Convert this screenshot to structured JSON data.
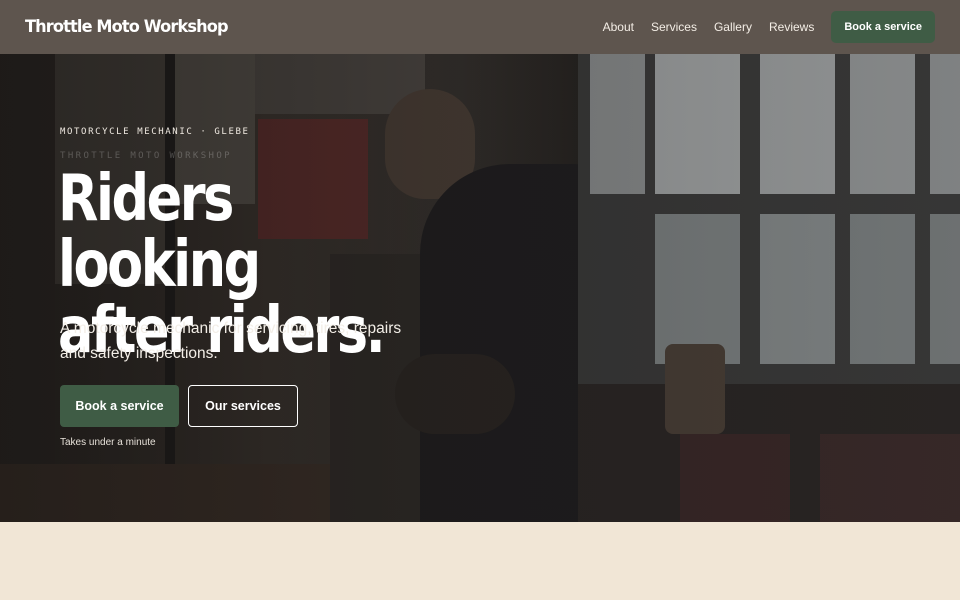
{
  "header": {
    "brand": "Throttle Moto Workshop",
    "nav": [
      "About",
      "Services",
      "Gallery",
      "Reviews"
    ],
    "cta": "Book a service"
  },
  "hero": {
    "eyebrow": "MOTORCYCLE MECHANIC · GLEBE",
    "eyebrow_faint": "THROTTLE MOTO WORKSHOP",
    "headline_line1": "Riders looking",
    "headline_line2": "after riders.",
    "subtext": "A motorcycle mechanic for servicing, tires, repairs and safety inspections.",
    "primary_button": "Book a service",
    "secondary_button": "Our services",
    "note": "Takes under a minute"
  },
  "colors": {
    "header_bg": "#5e554e",
    "accent": "#3f5c45",
    "page_bg": "#f1e6d6"
  }
}
